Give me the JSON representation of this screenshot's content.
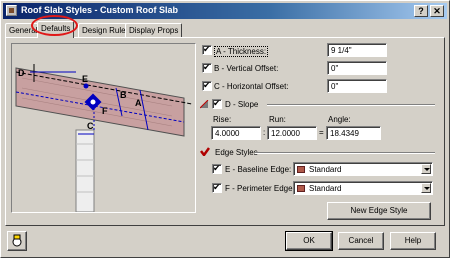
{
  "window": {
    "title": "Roof Slab Styles - Custom Roof Slab",
    "help_btn": "?",
    "close_btn": "✕"
  },
  "tabs": [
    "General",
    "Defaults",
    "Design Rules",
    "Display Props"
  ],
  "illustration": {
    "labels": {
      "d": "D",
      "e": "E",
      "b": "B",
      "a": "A",
      "f": "F",
      "c": "C"
    }
  },
  "fields": {
    "thickness": {
      "label": "A - Thickness:",
      "value": "9 1/4\"",
      "checked": true
    },
    "vertical_offset": {
      "label": "B - Vertical Offset:",
      "value": "0\"",
      "checked": true
    },
    "horizontal_offset": {
      "label": "C - Horizontal Offset:",
      "value": "0\"",
      "checked": true
    }
  },
  "slope": {
    "label": "D - Slope",
    "checked": true,
    "rise_label": "Rise:",
    "run_label": "Run:",
    "angle_label": "Angle:",
    "rise": "4.0000",
    "run": "12.0000",
    "angle": "18.4349",
    "colon": ":",
    "equals": "="
  },
  "edge_styles": {
    "heading": "Edge Styles",
    "baseline": {
      "label": "E - Baseline Edge:",
      "value": "Standard",
      "checked": true
    },
    "perimeter": {
      "label": "F - Perimeter Edges:",
      "value": "Standard",
      "checked": true
    },
    "new_button": "New Edge Style"
  },
  "footer": {
    "ok": "OK",
    "cancel": "Cancel",
    "help": "Help"
  },
  "colors": {
    "slab": "#c8a0a0",
    "highlight": "#e01818",
    "accent_blue": "#0000c0"
  }
}
